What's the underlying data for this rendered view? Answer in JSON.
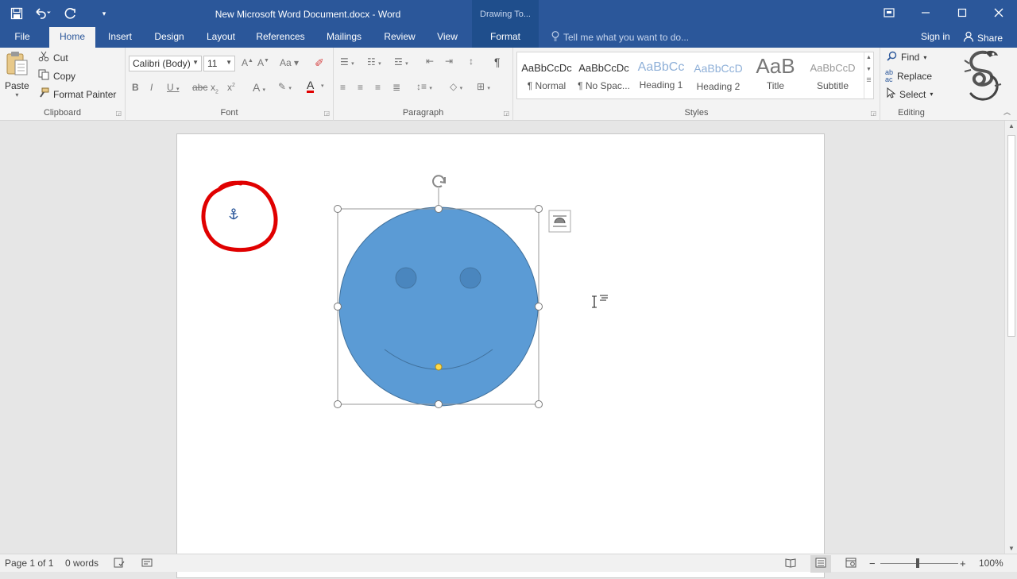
{
  "titlebar": {
    "document_title": "New Microsoft Word Document.docx - Word",
    "contextual_group": "Drawing To...",
    "qat": {
      "save": "save-icon",
      "undo": "undo-icon",
      "redo": "redo-icon",
      "customize": "customize-icon"
    }
  },
  "tabs": {
    "file": "File",
    "home": "Home",
    "insert": "Insert",
    "design": "Design",
    "layout": "Layout",
    "references": "References",
    "mailings": "Mailings",
    "review": "Review",
    "view": "View",
    "format": "Format"
  },
  "tellme": {
    "placeholder": "Tell me what you want to do..."
  },
  "account": {
    "signin": "Sign in",
    "share": "Share"
  },
  "clipboard": {
    "paste": "Paste",
    "cut": "Cut",
    "copy": "Copy",
    "format_painter": "Format Painter",
    "label": "Clipboard"
  },
  "font": {
    "name": "Calibri (Body)",
    "size": "11",
    "label": "Font"
  },
  "paragraph": {
    "label": "Paragraph"
  },
  "styles": {
    "label": "Styles",
    "items": [
      {
        "sample": "AaBbCcDc",
        "name": "¶ Normal"
      },
      {
        "sample": "AaBbCcDc",
        "name": "¶ No Spac..."
      },
      {
        "sample": "AaBbCc",
        "name": "Heading 1"
      },
      {
        "sample": "AaBbCcD",
        "name": "Heading 2"
      },
      {
        "sample": "AaB",
        "name": "Title"
      },
      {
        "sample": "AaBbCcD",
        "name": "Subtitle"
      }
    ]
  },
  "editing": {
    "find": "Find",
    "replace": "Replace",
    "select": "Select",
    "label": "Editing"
  },
  "document": {
    "shape": "smiley-face",
    "shape_fill": "#5b9bd5",
    "annotation_color": "#e00000"
  },
  "status": {
    "page": "Page 1 of 1",
    "words": "0 words",
    "zoom": "100%"
  }
}
